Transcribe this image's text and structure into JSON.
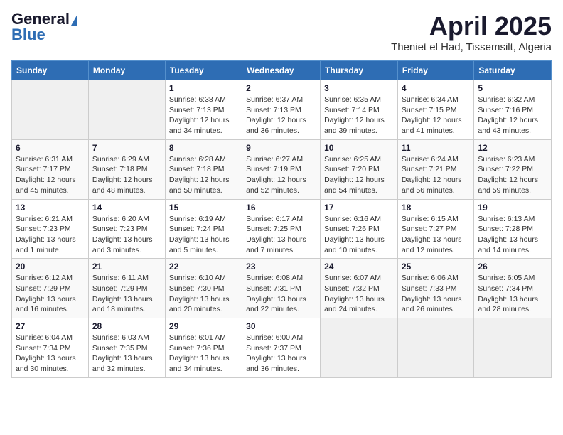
{
  "header": {
    "logo_general": "General",
    "logo_blue": "Blue",
    "title": "April 2025",
    "subtitle": "Theniet el Had, Tissemsilt, Algeria"
  },
  "weekdays": [
    "Sunday",
    "Monday",
    "Tuesday",
    "Wednesday",
    "Thursday",
    "Friday",
    "Saturday"
  ],
  "weeks": [
    [
      {
        "day": "",
        "info": ""
      },
      {
        "day": "",
        "info": ""
      },
      {
        "day": "1",
        "info": "Sunrise: 6:38 AM\nSunset: 7:13 PM\nDaylight: 12 hours and 34 minutes."
      },
      {
        "day": "2",
        "info": "Sunrise: 6:37 AM\nSunset: 7:13 PM\nDaylight: 12 hours and 36 minutes."
      },
      {
        "day": "3",
        "info": "Sunrise: 6:35 AM\nSunset: 7:14 PM\nDaylight: 12 hours and 39 minutes."
      },
      {
        "day": "4",
        "info": "Sunrise: 6:34 AM\nSunset: 7:15 PM\nDaylight: 12 hours and 41 minutes."
      },
      {
        "day": "5",
        "info": "Sunrise: 6:32 AM\nSunset: 7:16 PM\nDaylight: 12 hours and 43 minutes."
      }
    ],
    [
      {
        "day": "6",
        "info": "Sunrise: 6:31 AM\nSunset: 7:17 PM\nDaylight: 12 hours and 45 minutes."
      },
      {
        "day": "7",
        "info": "Sunrise: 6:29 AM\nSunset: 7:18 PM\nDaylight: 12 hours and 48 minutes."
      },
      {
        "day": "8",
        "info": "Sunrise: 6:28 AM\nSunset: 7:18 PM\nDaylight: 12 hours and 50 minutes."
      },
      {
        "day": "9",
        "info": "Sunrise: 6:27 AM\nSunset: 7:19 PM\nDaylight: 12 hours and 52 minutes."
      },
      {
        "day": "10",
        "info": "Sunrise: 6:25 AM\nSunset: 7:20 PM\nDaylight: 12 hours and 54 minutes."
      },
      {
        "day": "11",
        "info": "Sunrise: 6:24 AM\nSunset: 7:21 PM\nDaylight: 12 hours and 56 minutes."
      },
      {
        "day": "12",
        "info": "Sunrise: 6:23 AM\nSunset: 7:22 PM\nDaylight: 12 hours and 59 minutes."
      }
    ],
    [
      {
        "day": "13",
        "info": "Sunrise: 6:21 AM\nSunset: 7:23 PM\nDaylight: 13 hours and 1 minute."
      },
      {
        "day": "14",
        "info": "Sunrise: 6:20 AM\nSunset: 7:23 PM\nDaylight: 13 hours and 3 minutes."
      },
      {
        "day": "15",
        "info": "Sunrise: 6:19 AM\nSunset: 7:24 PM\nDaylight: 13 hours and 5 minutes."
      },
      {
        "day": "16",
        "info": "Sunrise: 6:17 AM\nSunset: 7:25 PM\nDaylight: 13 hours and 7 minutes."
      },
      {
        "day": "17",
        "info": "Sunrise: 6:16 AM\nSunset: 7:26 PM\nDaylight: 13 hours and 10 minutes."
      },
      {
        "day": "18",
        "info": "Sunrise: 6:15 AM\nSunset: 7:27 PM\nDaylight: 13 hours and 12 minutes."
      },
      {
        "day": "19",
        "info": "Sunrise: 6:13 AM\nSunset: 7:28 PM\nDaylight: 13 hours and 14 minutes."
      }
    ],
    [
      {
        "day": "20",
        "info": "Sunrise: 6:12 AM\nSunset: 7:29 PM\nDaylight: 13 hours and 16 minutes."
      },
      {
        "day": "21",
        "info": "Sunrise: 6:11 AM\nSunset: 7:29 PM\nDaylight: 13 hours and 18 minutes."
      },
      {
        "day": "22",
        "info": "Sunrise: 6:10 AM\nSunset: 7:30 PM\nDaylight: 13 hours and 20 minutes."
      },
      {
        "day": "23",
        "info": "Sunrise: 6:08 AM\nSunset: 7:31 PM\nDaylight: 13 hours and 22 minutes."
      },
      {
        "day": "24",
        "info": "Sunrise: 6:07 AM\nSunset: 7:32 PM\nDaylight: 13 hours and 24 minutes."
      },
      {
        "day": "25",
        "info": "Sunrise: 6:06 AM\nSunset: 7:33 PM\nDaylight: 13 hours and 26 minutes."
      },
      {
        "day": "26",
        "info": "Sunrise: 6:05 AM\nSunset: 7:34 PM\nDaylight: 13 hours and 28 minutes."
      }
    ],
    [
      {
        "day": "27",
        "info": "Sunrise: 6:04 AM\nSunset: 7:34 PM\nDaylight: 13 hours and 30 minutes."
      },
      {
        "day": "28",
        "info": "Sunrise: 6:03 AM\nSunset: 7:35 PM\nDaylight: 13 hours and 32 minutes."
      },
      {
        "day": "29",
        "info": "Sunrise: 6:01 AM\nSunset: 7:36 PM\nDaylight: 13 hours and 34 minutes."
      },
      {
        "day": "30",
        "info": "Sunrise: 6:00 AM\nSunset: 7:37 PM\nDaylight: 13 hours and 36 minutes."
      },
      {
        "day": "",
        "info": ""
      },
      {
        "day": "",
        "info": ""
      },
      {
        "day": "",
        "info": ""
      }
    ]
  ]
}
